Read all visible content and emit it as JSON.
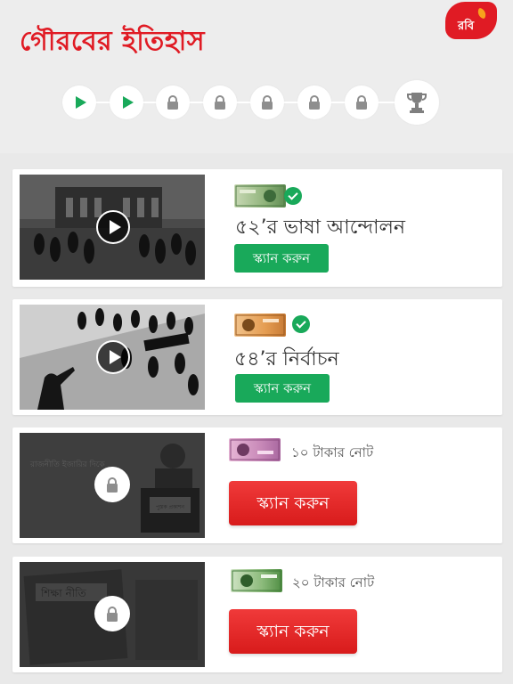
{
  "header": {
    "title": "গৌরবের ইতিহাস",
    "logo_text": "রবি"
  },
  "progress": {
    "steps": [
      {
        "state": "played",
        "icon": "play-icon"
      },
      {
        "state": "played",
        "icon": "play-icon"
      },
      {
        "state": "locked",
        "icon": "lock-icon"
      },
      {
        "state": "locked",
        "icon": "lock-icon"
      },
      {
        "state": "locked",
        "icon": "lock-icon"
      },
      {
        "state": "locked",
        "icon": "lock-icon"
      },
      {
        "state": "locked",
        "icon": "lock-icon"
      },
      {
        "state": "goal",
        "icon": "trophy-icon"
      }
    ]
  },
  "episodes": [
    {
      "title": "৫২’র ভাষা আন্দোলন",
      "button": "স্ক্যান করুন",
      "status": "unlocked",
      "note": "note-2-taka"
    },
    {
      "title": "৫৪’র নির্বাচন",
      "button": "স্ক্যান করুন",
      "status": "unlocked",
      "note": "note-5-taka"
    },
    {
      "subtitle": "১০ টাকার নোট",
      "button": "স্ক্যান করুন",
      "status": "locked",
      "thumb_caption": "রাজনীতি ইজারির দিকে",
      "thumb_sign": "পুস্তক প্রকাশন"
    },
    {
      "subtitle": "২০ টাকার নোট",
      "button": "স্ক্যান করুন",
      "status": "locked",
      "thumb_caption": "শিক্ষা নীতি"
    }
  ],
  "colors": {
    "brand_red": "#e01b24",
    "success_green": "#19a95a",
    "background": "#e9e9e9"
  }
}
